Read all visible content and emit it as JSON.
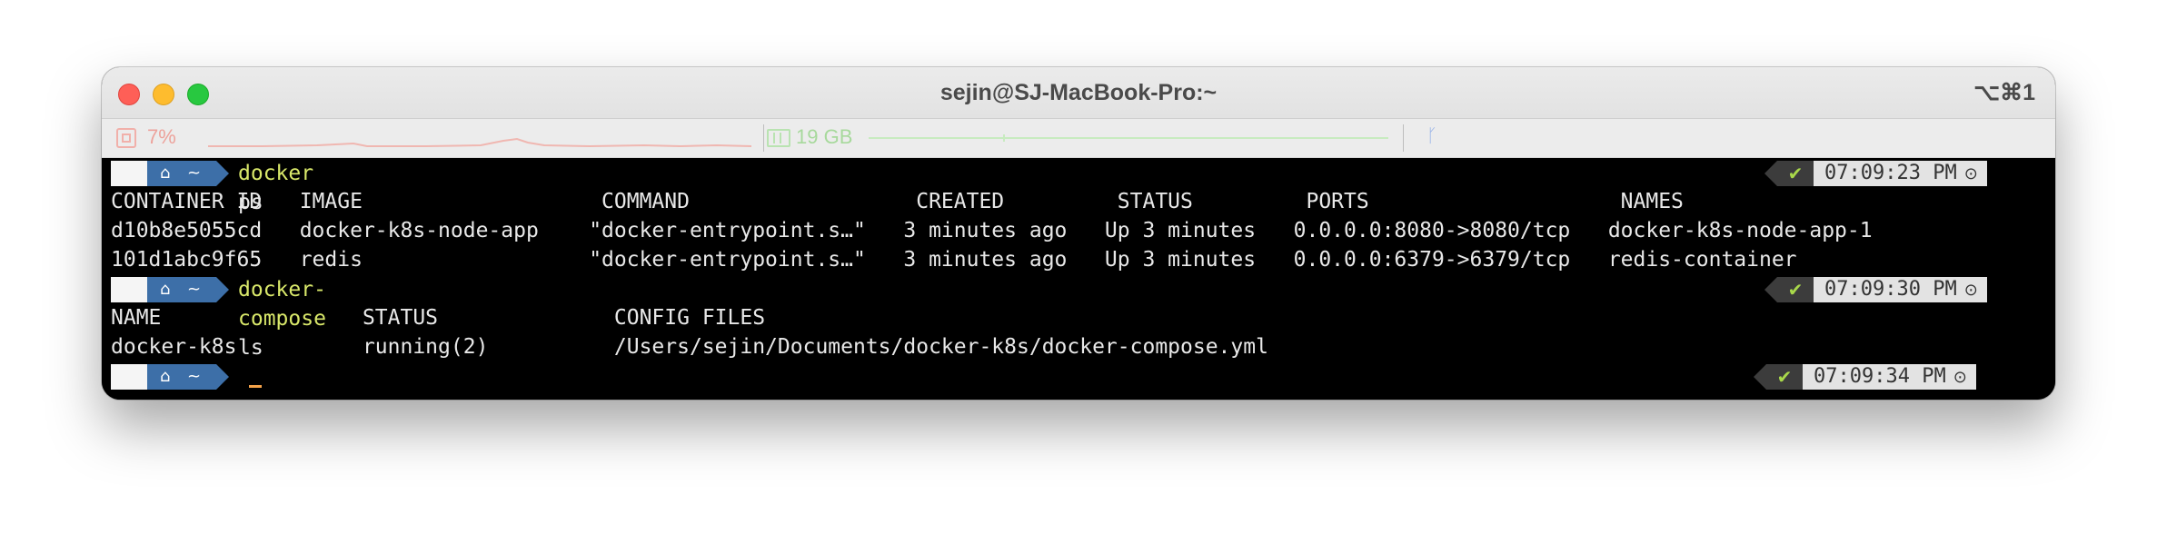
{
  "window": {
    "title": "sejin@SJ-MacBook-Pro:~",
    "shortcut": "⌥⌘1"
  },
  "statusbar": {
    "cpu": "7%",
    "memory": "19 GB",
    "icons": [
      "cpu-icon",
      "memory-icon",
      "git-branch-icon"
    ],
    "colors": {
      "cpu": "#eda29b",
      "memory": "#a7d99c",
      "branch": "#9bb5e8"
    }
  },
  "prompt": {
    "apple": "",
    "home": "⌂",
    "dir": "~",
    "check": "✔",
    "colors": {
      "home_segment": "#3d6fa8",
      "command": "#d9e86a",
      "check": "#a8d84a",
      "cursor": "#f5a34a"
    }
  },
  "session": {
    "cmd1": {
      "name": "docker",
      "args": "ps",
      "time": "07:09:23 PM"
    },
    "ps_header": "CONTAINER ID   IMAGE                   COMMAND                  CREATED         STATUS         PORTS                    NAMES",
    "ps_rows": [
      "d10b8e5055cd   docker-k8s-node-app    \"docker-entrypoint.s…\"   3 minutes ago   Up 3 minutes   0.0.0.0:8080->8080/tcp   docker-k8s-node-app-1",
      "101d1abc9f65   redis                  \"docker-entrypoint.s…\"   3 minutes ago   Up 3 minutes   0.0.0.0:6379->6379/tcp   redis-container"
    ],
    "cmd2": {
      "name": "docker-compose",
      "args": "ls",
      "time": "07:09:30 PM"
    },
    "ls_header": "NAME                STATUS              CONFIG FILES",
    "ls_rows": [
      "docker-k8s          running(2)          /Users/sejin/Documents/docker-k8s/docker-compose.yml"
    ],
    "cmd3": {
      "time": "07:09:34 PM"
    }
  }
}
